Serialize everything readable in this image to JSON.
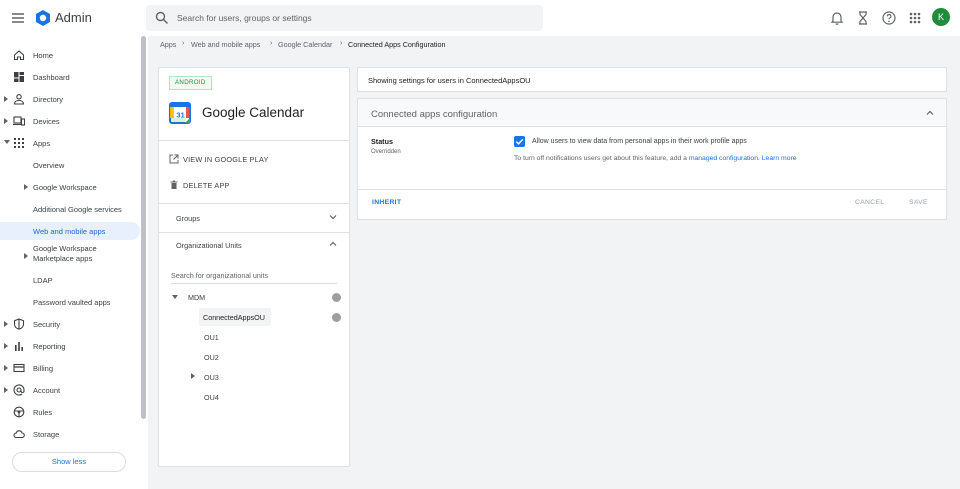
{
  "header": {
    "app_name": "Admin",
    "search_placeholder": "Search for users, groups or settings",
    "avatar_initial": "K",
    "icons": [
      "menu-icon",
      "admin-logo-icon",
      "search-icon",
      "bell-icon",
      "hourglass-icon",
      "help-icon",
      "apps-grid-icon"
    ]
  },
  "sidebar": {
    "items": [
      {
        "label": "Home",
        "icon": "home-icon"
      },
      {
        "label": "Dashboard",
        "icon": "dashboard-icon"
      },
      {
        "label": "Directory",
        "icon": "person-icon"
      },
      {
        "label": "Devices",
        "icon": "devices-icon"
      },
      {
        "label": "Apps",
        "icon": "apps-icon"
      },
      {
        "label": "Overview"
      },
      {
        "label": "Google Workspace"
      },
      {
        "label": "Additional Google services"
      },
      {
        "label": "Web and mobile apps"
      },
      {
        "label": "Google Workspace Marketplace apps"
      },
      {
        "label": "LDAP"
      },
      {
        "label": "Password vaulted apps"
      },
      {
        "label": "Security",
        "icon": "shield-icon"
      },
      {
        "label": "Reporting",
        "icon": "bar-chart-icon"
      },
      {
        "label": "Billing",
        "icon": "billing-icon"
      },
      {
        "label": "Account",
        "icon": "at-icon"
      },
      {
        "label": "Rules",
        "icon": "rules-icon"
      },
      {
        "label": "Storage",
        "icon": "cloud-icon"
      }
    ],
    "show_less": "Show less"
  },
  "breadcrumb": [
    "Apps",
    "Web and mobile apps",
    "Google Calendar",
    "Connected Apps Configuration"
  ],
  "app_panel": {
    "platform_badge": "ANDROID",
    "app_title": "Google Calendar",
    "calendar_icon_text": "31",
    "view_action": "VIEW IN GOOGLE PLAY",
    "delete_action": "DELETE APP",
    "groups_label": "Groups",
    "org_units_label": "Organizational Units",
    "ou_search_placeholder": "Search for organizational units",
    "tree": {
      "root": "MDM",
      "selected": "ConnectedAppsOU",
      "children": [
        "OU1",
        "OU2",
        "OU3",
        "OU4"
      ]
    }
  },
  "settings": {
    "showing_prefix": "Showing settings for users in ",
    "showing_ou": "ConnectedAppsOU",
    "card_title": "Connected apps configuration",
    "status_label": "Status",
    "status_sub": "Overridden",
    "checkbox_label": "Allow users to view data from personal apps in their work profile apps",
    "checkbox_checked": true,
    "note_text": "To turn off notifications users get about this feature, add a ",
    "note_link": "managed configuration.",
    "learn_more": "Learn more",
    "inherit": "INHERIT",
    "cancel": "CANCEL",
    "save": "SAVE"
  },
  "colors": {
    "accent": "#1a73e8",
    "avatar": "#1e8e3e",
    "badge_green": "#1e8e3e"
  }
}
